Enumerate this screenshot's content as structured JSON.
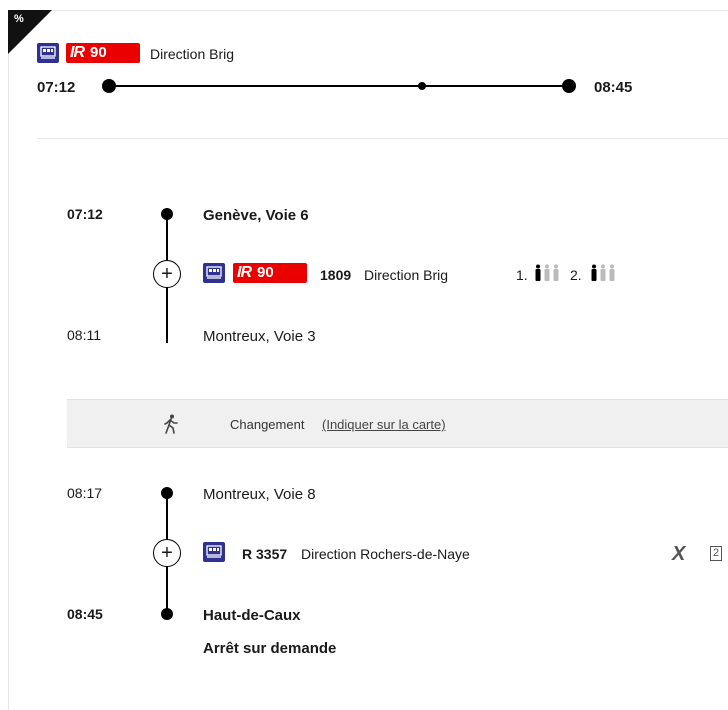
{
  "summary": {
    "corner_symbol": "%",
    "line_label": "90",
    "line_prefix": "IR",
    "direction": "Direction Brig",
    "depart_time": "07:12",
    "arrive_time": "08:45"
  },
  "legs": [
    {
      "from_time": "07:12",
      "from_stop": "Genève, Voie 6",
      "line_prefix": "IR",
      "line_label": "90",
      "train_number": "1809",
      "direction": "Direction Brig",
      "class1": "1.",
      "class2": "2.",
      "to_time": "08:11",
      "to_stop": "Montreux, Voie 3"
    },
    {
      "from_time": "08:17",
      "from_stop": "Montreux, Voie 8",
      "train_number": "R 3357",
      "direction": "Direction Rochers-de-Naye",
      "tag_x": "X",
      "tag_class": "2",
      "to_time": "08:45",
      "to_stop": "Haut-de-Caux",
      "note": "Arrêt sur demande"
    }
  ],
  "transfer": {
    "label": "Changement",
    "link": "(Indiquer sur la carte)",
    "icon": "walking-person-icon"
  },
  "colors": {
    "sbb_red": "#eb0000",
    "train_blue": "#2e3192",
    "transfer_bg": "#f0f0f0"
  }
}
